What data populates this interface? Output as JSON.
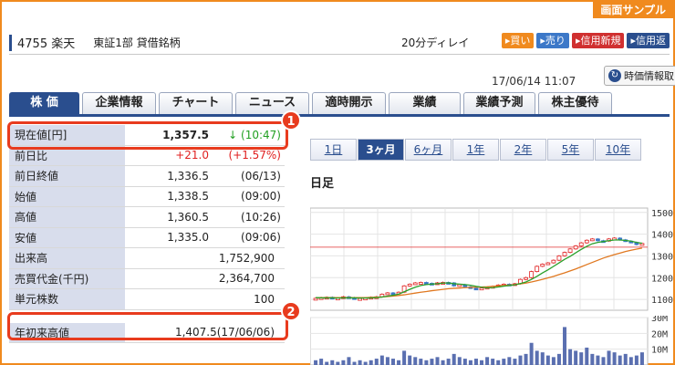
{
  "badge": "画面サンプル",
  "header": {
    "code_name": "4755 楽天",
    "market": "東証1部 貸借銘柄",
    "delay": "20分ディレイ",
    "buttons": [
      {
        "label": "▸買い",
        "kind": "buy"
      },
      {
        "label": "▸売り",
        "kind": "sell"
      },
      {
        "label": "▸信用新規",
        "kind": "margin-new"
      },
      {
        "label": "▸信用返",
        "kind": "margin-ret"
      }
    ]
  },
  "datetime": "17/06/14 11:07",
  "refresh_label": "時価情報取",
  "tabs": [
    "株 価",
    "企業情報",
    "チャート",
    "ニュース",
    "適時開示",
    "業績",
    "業績予測",
    "株主優待"
  ],
  "quote": [
    {
      "label": "現在値[円]",
      "value": "1,357.5",
      "sub": "↓ (10:47)"
    },
    {
      "label": "前日比",
      "value": "+21.0",
      "sub": "(+1.57%)"
    },
    {
      "label": "前日終値",
      "value": "1,336.5",
      "sub": "(06/13)"
    },
    {
      "label": "始値",
      "value": "1,338.5",
      "sub": "(09:00)"
    },
    {
      "label": "高値",
      "value": "1,360.5",
      "sub": "(10:26)"
    },
    {
      "label": "安値",
      "value": "1,335.0",
      "sub": "(09:06)"
    },
    {
      "label": "出来高",
      "value": "1,752,900",
      "sub": ""
    },
    {
      "label": "売買代金(千円)",
      "value": "2,364,700",
      "sub": ""
    },
    {
      "label": "単元株数",
      "value": "100",
      "sub": ""
    },
    {
      "label": "",
      "value": "",
      "sub": ""
    },
    {
      "label": "年初来高値",
      "value": "1,407.5(17/06/06)",
      "sub": ""
    }
  ],
  "callouts": [
    "1",
    "2"
  ],
  "periods": [
    "1日",
    "3ヶ月",
    "6ヶ月",
    "1年",
    "2年",
    "5年",
    "10年"
  ],
  "active_period": "3ヶ月",
  "chart_title": "日足",
  "colors": {
    "accent": "#2a4e8e",
    "up": "#e02020",
    "down": "#3c78c8",
    "highlight": "#e83b1e",
    "badge": "#f08a1e"
  },
  "chart_data": [
    {
      "type": "candlestick",
      "title": "日足",
      "y_ticks": [
        1100,
        1200,
        1300,
        1400,
        1500
      ],
      "ylim": [
        1050,
        1520
      ],
      "reference_line": 1340,
      "close": [
        1105,
        1108,
        1110,
        1104,
        1106,
        1112,
        1108,
        1102,
        1104,
        1106,
        1110,
        1112,
        1124,
        1130,
        1128,
        1133,
        1162,
        1170,
        1176,
        1178,
        1174,
        1172,
        1176,
        1178,
        1176,
        1162,
        1168,
        1158,
        1152,
        1148,
        1152,
        1156,
        1160,
        1166,
        1170,
        1168,
        1172,
        1192,
        1200,
        1228,
        1252,
        1262,
        1268,
        1280,
        1300,
        1316,
        1332,
        1346,
        1360,
        1372,
        1378,
        1370,
        1368,
        1378,
        1382,
        1374,
        1368,
        1362,
        1352,
        1357
      ],
      "ma_short": [
        1108,
        1107,
        1107,
        1107,
        1106,
        1107,
        1107,
        1107,
        1106,
        1106,
        1107,
        1108,
        1111,
        1115,
        1119,
        1124,
        1135,
        1146,
        1156,
        1164,
        1168,
        1170,
        1172,
        1175,
        1176,
        1172,
        1170,
        1168,
        1165,
        1160,
        1156,
        1153,
        1154,
        1157,
        1161,
        1164,
        1167,
        1173,
        1180,
        1192,
        1206,
        1222,
        1236,
        1252,
        1268,
        1284,
        1298,
        1314,
        1330,
        1344,
        1356,
        1362,
        1366,
        1370,
        1373,
        1373,
        1371,
        1368,
        1362,
        1358
      ],
      "ma_long": [
        1108,
        1108,
        1108,
        1108,
        1108,
        1108,
        1108,
        1108,
        1108,
        1108,
        1109,
        1110,
        1111,
        1113,
        1115,
        1118,
        1121,
        1125,
        1129,
        1133,
        1136,
        1140,
        1143,
        1146,
        1149,
        1151,
        1152,
        1154,
        1155,
        1156,
        1157,
        1158,
        1160,
        1162,
        1164,
        1166,
        1168,
        1171,
        1175,
        1180,
        1186,
        1192,
        1199,
        1206,
        1214,
        1222,
        1231,
        1240,
        1250,
        1260,
        1270,
        1280,
        1290,
        1298,
        1306,
        1313,
        1320,
        1326,
        1331,
        1336
      ]
    },
    {
      "type": "bar",
      "title": "",
      "y_ticks": [
        "10M",
        "20M",
        "30M"
      ],
      "ylim": [
        0,
        30
      ],
      "values": [
        3,
        4,
        2,
        3,
        2,
        3,
        5,
        2,
        3,
        2,
        3,
        4,
        6,
        5,
        4,
        3,
        9,
        6,
        5,
        4,
        3,
        4,
        5,
        3,
        4,
        7,
        5,
        4,
        3,
        4,
        3,
        5,
        4,
        3,
        4,
        5,
        4,
        6,
        7,
        14,
        9,
        8,
        6,
        5,
        7,
        24,
        10,
        9,
        8,
        11,
        7,
        6,
        5,
        9,
        8,
        6,
        7,
        5,
        6,
        8
      ]
    }
  ]
}
